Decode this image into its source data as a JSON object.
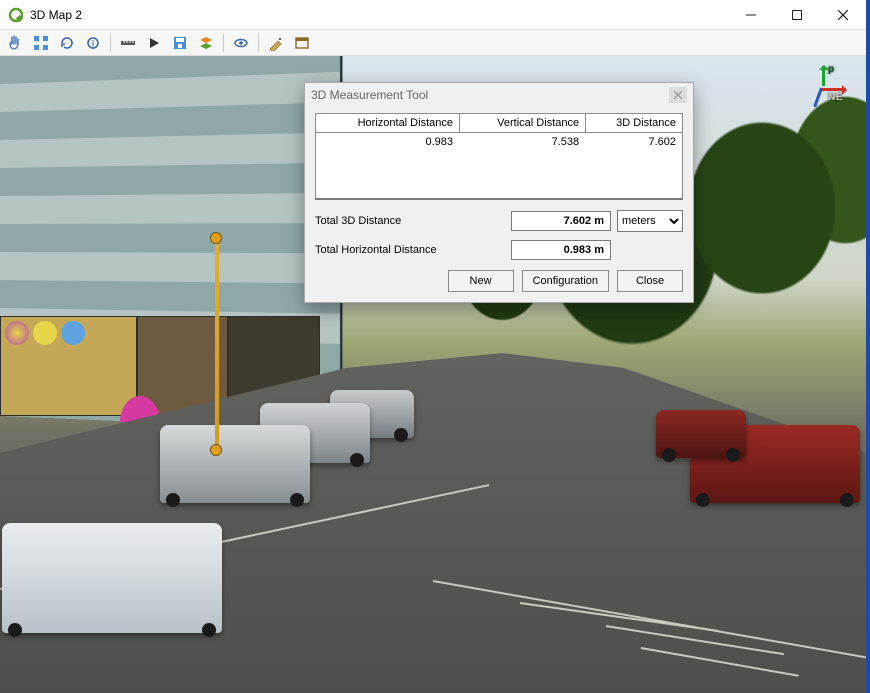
{
  "window": {
    "title": "3D Map 2"
  },
  "titlebar_buttons": {
    "minimize": "minimize",
    "maximize": "maximize",
    "close": "close"
  },
  "toolbar": [
    {
      "name": "pan-tool-icon"
    },
    {
      "name": "zoom-extents-icon"
    },
    {
      "name": "refresh-icon"
    },
    {
      "name": "identify-icon"
    },
    {
      "name": "sep"
    },
    {
      "name": "measure-icon"
    },
    {
      "name": "play-icon"
    },
    {
      "name": "save-image-icon"
    },
    {
      "name": "layers-icon"
    },
    {
      "name": "sep"
    },
    {
      "name": "view-settings-icon"
    },
    {
      "name": "sep"
    },
    {
      "name": "options-icon"
    },
    {
      "name": "dock-icon"
    }
  ],
  "gizmo": {
    "up": "p",
    "east": "E",
    "north": "N"
  },
  "dialog": {
    "title": "3D Measurement Tool",
    "headers": {
      "h": "Horizontal Distance",
      "v": "Vertical Distance",
      "d3": "3D Distance"
    },
    "rows": [
      {
        "h": "0.983",
        "v": "7.538",
        "d3": "7.602"
      }
    ],
    "total_3d_label": "Total 3D Distance",
    "total_3d_value": "7.602 m",
    "total_h_label": "Total Horizontal Distance",
    "total_h_value": "0.983 m",
    "unit_selected": "meters",
    "buttons": {
      "new": "New",
      "config": "Configuration",
      "close": "Close"
    }
  }
}
